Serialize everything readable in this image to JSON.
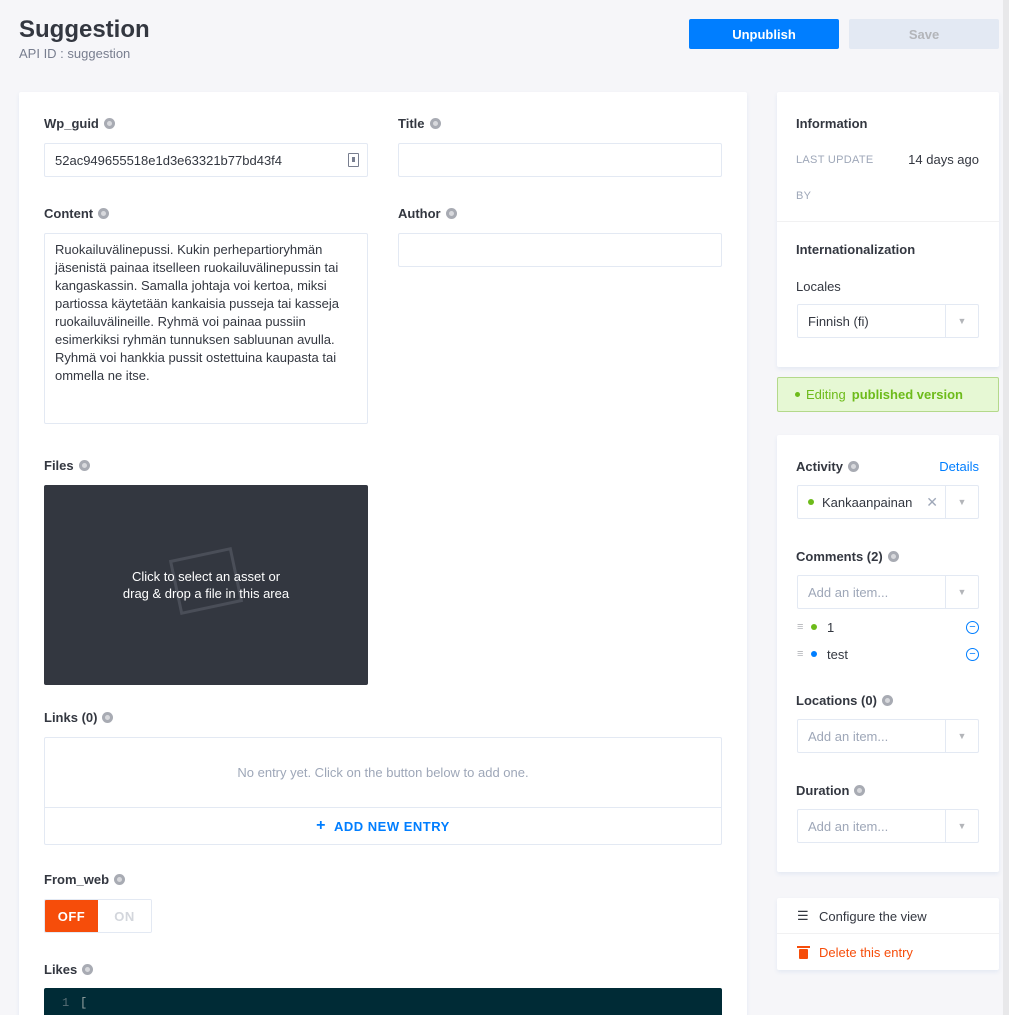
{
  "header": {
    "title": "Suggestion",
    "api_id": "API ID : suggestion",
    "unpublish_label": "Unpublish",
    "save_label": "Save"
  },
  "fields": {
    "wp_guid": {
      "label": "Wp_guid",
      "value": "52ac949655518e1d3e63321b77bd43f4"
    },
    "title": {
      "label": "Title",
      "value": ""
    },
    "content": {
      "label": "Content",
      "value": "Ruokailuvälinepussi. Kukin perhepartioryhmän jäsenistä painaa itselleen ruokailuvälinepussin tai kangaskassin. Samalla johtaja voi kertoa, miksi partiossa käytetään kankaisia pusseja tai kasseja ruokailuvälineille. Ryhmä voi painaa pussiin esimerkiksi ryhmän tunnuksen sabluunan avulla. Ryhmä voi hankkia pussit ostettuina kaupasta tai ommella ne itse."
    },
    "author": {
      "label": "Author",
      "value": ""
    },
    "files": {
      "label": "Files",
      "drop_text_line1": "Click to select an asset or",
      "drop_text_line2": "drag & drop a file in this area"
    },
    "links": {
      "label": "Links (0)",
      "empty_text": "No entry yet. Click on the button below to add one.",
      "add_label": "ADD NEW ENTRY"
    },
    "from_web": {
      "label": "From_web",
      "off": "OFF",
      "on": "ON",
      "value": "OFF"
    },
    "likes": {
      "label": "Likes",
      "line_number": "1",
      "code": "["
    }
  },
  "sidebar": {
    "information": {
      "title": "Information",
      "last_update_label": "LAST UPDATE",
      "last_update_value": "14 days ago",
      "by_label": "BY"
    },
    "i18n": {
      "title": "Internationalization",
      "locales_label": "Locales",
      "locale_value": "Finnish (fi)"
    },
    "status": {
      "prefix": "Editing",
      "strong": "published version"
    },
    "relations": {
      "activity_label": "Activity",
      "details_label": "Details",
      "activity_value": "Kankaanpainan",
      "comments_label": "Comments (2)",
      "comments_placeholder": "Add an item...",
      "comments": [
        {
          "text": "1",
          "color": "#6dbb1a"
        },
        {
          "text": "test",
          "color": "#007eff"
        }
      ],
      "locations_label": "Locations (0)",
      "locations_placeholder": "Add an item...",
      "duration_label": "Duration",
      "duration_placeholder": "Add an item..."
    },
    "actions": {
      "configure_label": "Configure the view",
      "delete_label": "Delete this entry"
    }
  },
  "colors": {
    "primary": "#007eff",
    "danger": "#f64d0a",
    "success": "#6dbb1a"
  }
}
